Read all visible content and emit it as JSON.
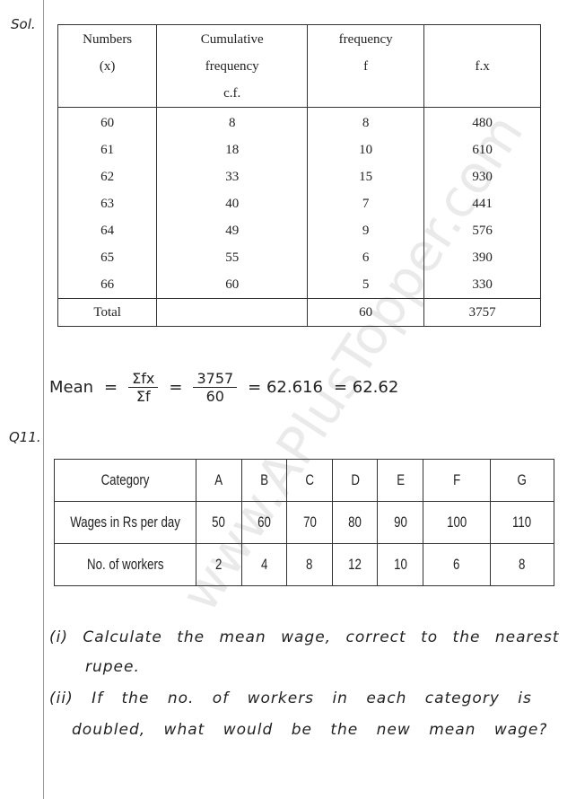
{
  "labels": {
    "sol": "Sol.",
    "q11": "Q11."
  },
  "table1": {
    "headers": [
      [
        "Numbers",
        "(x)"
      ],
      [
        "Cumulative",
        "frequency",
        "c.f."
      ],
      [
        "frequency",
        "f"
      ],
      [
        "f.x"
      ]
    ],
    "rows": [
      [
        "60",
        "8",
        "8",
        "480"
      ],
      [
        "61",
        "18",
        "10",
        "610"
      ],
      [
        "62",
        "33",
        "15",
        "930"
      ],
      [
        "63",
        "40",
        "7",
        "441"
      ],
      [
        "64",
        "49",
        "9",
        "576"
      ],
      [
        "65",
        "55",
        "6",
        "390"
      ],
      [
        "66",
        "60",
        "5",
        "330"
      ]
    ],
    "total": [
      "Total",
      "",
      "60",
      "3757"
    ]
  },
  "mean": {
    "label": "Mean",
    "eq": "=",
    "frac1_num": "Σfx",
    "frac1_den": "Σf",
    "frac2_num": "3757",
    "frac2_den": "60",
    "result1": "= 62.616",
    "result2": "= 62.62"
  },
  "table2": {
    "header_row": [
      "Category",
      "A",
      "B",
      "C",
      "D",
      "E",
      "F",
      "G"
    ],
    "wages_row": [
      "Wages in Rs per day",
      "50",
      "60",
      "70",
      "80",
      "90",
      "100",
      "110"
    ],
    "workers_row": [
      "No. of workers",
      "2",
      "4",
      "8",
      "12",
      "10",
      "6",
      "8"
    ]
  },
  "questions": {
    "q1_line1": "(i) Calculate the mean wage, correct to the nearest",
    "q1_line2": "rupee.",
    "q2_line1": "(ii) If the no. of workers in each category is",
    "q2_line2": "doubled, what would be the new mean wage?"
  },
  "watermark": "www.APlusTopper.com"
}
